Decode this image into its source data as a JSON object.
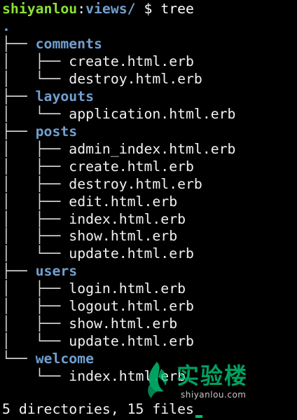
{
  "terminal": {
    "prompt": {
      "user": "shiyanlou",
      "separator": ":",
      "path": "views/",
      "symbol": " $",
      "command": " tree"
    },
    "root": ".",
    "entries": [
      {
        "prefix": "├── ",
        "name": "comments",
        "kind": "dir"
      },
      {
        "prefix": "│   ├── ",
        "name": "create.html.erb",
        "kind": "file"
      },
      {
        "prefix": "│   └── ",
        "name": "destroy.html.erb",
        "kind": "file"
      },
      {
        "prefix": "├── ",
        "name": "layouts",
        "kind": "dir"
      },
      {
        "prefix": "│   └── ",
        "name": "application.html.erb",
        "kind": "file"
      },
      {
        "prefix": "├── ",
        "name": "posts",
        "kind": "dir"
      },
      {
        "prefix": "│   ├── ",
        "name": "admin_index.html.erb",
        "kind": "file"
      },
      {
        "prefix": "│   ├── ",
        "name": "create.html.erb",
        "kind": "file"
      },
      {
        "prefix": "│   ├── ",
        "name": "destroy.html.erb",
        "kind": "file"
      },
      {
        "prefix": "│   ├── ",
        "name": "edit.html.erb",
        "kind": "file"
      },
      {
        "prefix": "│   ├── ",
        "name": "index.html.erb",
        "kind": "file"
      },
      {
        "prefix": "│   ├── ",
        "name": "show.html.erb",
        "kind": "file"
      },
      {
        "prefix": "│   └── ",
        "name": "update.html.erb",
        "kind": "file"
      },
      {
        "prefix": "├── ",
        "name": "users",
        "kind": "dir"
      },
      {
        "prefix": "│   ├── ",
        "name": "login.html.erb",
        "kind": "file"
      },
      {
        "prefix": "│   ├── ",
        "name": "logout.html.erb",
        "kind": "file"
      },
      {
        "prefix": "│   ├── ",
        "name": "show.html.erb",
        "kind": "file"
      },
      {
        "prefix": "│   └── ",
        "name": "update.html.erb",
        "kind": "file"
      },
      {
        "prefix": "└── ",
        "name": "welcome",
        "kind": "dir"
      },
      {
        "prefix": "    └── ",
        "name": "index.html.erb",
        "kind": "file"
      }
    ],
    "summary": "5 directories, 15 files"
  },
  "watermark": {
    "brand_text": "实验楼",
    "url": "shiyanlou.com",
    "icon": "shiyanlou-logo-icon",
    "color": "#00b36b"
  },
  "colors": {
    "background": "#000000",
    "prompt_user": "#8ae234",
    "directory": "#729fcf",
    "file": "#f2f2f2",
    "cursor": "#00c06a"
  }
}
